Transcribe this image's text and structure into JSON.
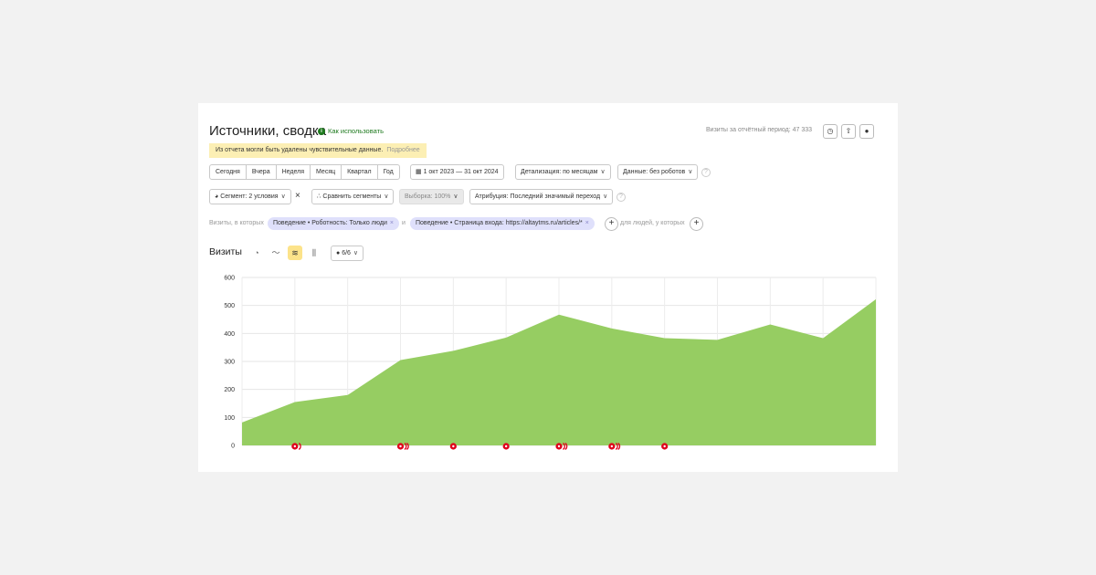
{
  "header": {
    "title": "Источники, сводка",
    "howto_label": "Как использовать",
    "visits_total": "Визиты за отчётный период: 47 333"
  },
  "warning": {
    "text": "Из отчета могли быть удалены чувствительные данные.",
    "more": "Подробнее"
  },
  "periods": [
    "Сегодня",
    "Вчера",
    "Неделя",
    "Месяц",
    "Квартал",
    "Год"
  ],
  "date_range": "1 окт 2023 — 31 окт 2024",
  "detail_label": "Детализация: по месяцам",
  "data_label": "Данные: без роботов",
  "segment_label": "Сегмент: 2 условия",
  "compare_label": "Сравнить сегменты",
  "sample_label": "Выборка: 100%",
  "attribution_label": "Атрибуция: Последний значимый переход",
  "filters": {
    "prefix": "Визиты, в которых",
    "tag1": "Поведение • Роботность: Только люди",
    "and": "и",
    "tag2": "Поведение • Страница входа: https://altaytms.ru/articles/*",
    "suffix": "для людей, у которых"
  },
  "chart_section": {
    "title": "Визиты",
    "series_count": "6/6"
  },
  "colors": {
    "area": "#96cd62",
    "marker": "#e0001b",
    "accent_green": "#1f7a1f",
    "warning_bg": "#fcefb4",
    "tag_bg": "#dfe0fb"
  },
  "chart_data": {
    "type": "area",
    "values": [
      82,
      155,
      180,
      305,
      338,
      385,
      467,
      418,
      383,
      377,
      432,
      383,
      522
    ],
    "ylim": [
      0,
      600
    ],
    "yticks": [
      "0",
      "100",
      "200",
      "300",
      "400",
      "500",
      "600"
    ],
    "grid": true,
    "annotation_markers": [
      {
        "index": 1,
        "count": 2
      },
      {
        "index": 3,
        "count": 3
      },
      {
        "index": 4,
        "count": 1
      },
      {
        "index": 5,
        "count": 1
      },
      {
        "index": 6,
        "count": 3
      },
      {
        "index": 7,
        "count": 3
      },
      {
        "index": 8,
        "count": 1
      }
    ]
  }
}
